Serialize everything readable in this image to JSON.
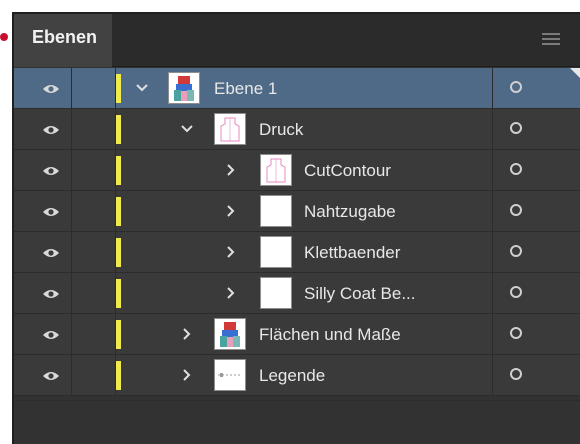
{
  "panel": {
    "tab_label": "Ebenen",
    "menu_icon": "hamburger-menu-icon"
  },
  "colors": {
    "row_bg": "#3a3a3a",
    "selected_bg": "#4e6a86",
    "layer_color": "#f0ea4a",
    "annotation": "#c8102e"
  },
  "layers": [
    {
      "name": "Ebene 1",
      "level": 0,
      "expanded": true,
      "selected": true,
      "thumb": "figure"
    },
    {
      "name": "Druck",
      "level": 1,
      "expanded": true,
      "selected": false,
      "thumb": "outline"
    },
    {
      "name": "CutContour",
      "level": 2,
      "expanded": false,
      "selected": false,
      "thumb": "outline"
    },
    {
      "name": "Nahtzugabe",
      "level": 2,
      "expanded": false,
      "selected": false,
      "thumb": "blank"
    },
    {
      "name": "Klettbaender",
      "level": 2,
      "expanded": false,
      "selected": false,
      "thumb": "blank"
    },
    {
      "name": "Silly Coat Be...",
      "level": 2,
      "expanded": false,
      "selected": false,
      "thumb": "blank"
    },
    {
      "name": "Flächen und Maße",
      "level": 1,
      "expanded": false,
      "selected": false,
      "thumb": "figure"
    },
    {
      "name": "Legende",
      "level": 1,
      "expanded": false,
      "selected": false,
      "thumb": "legend"
    }
  ]
}
